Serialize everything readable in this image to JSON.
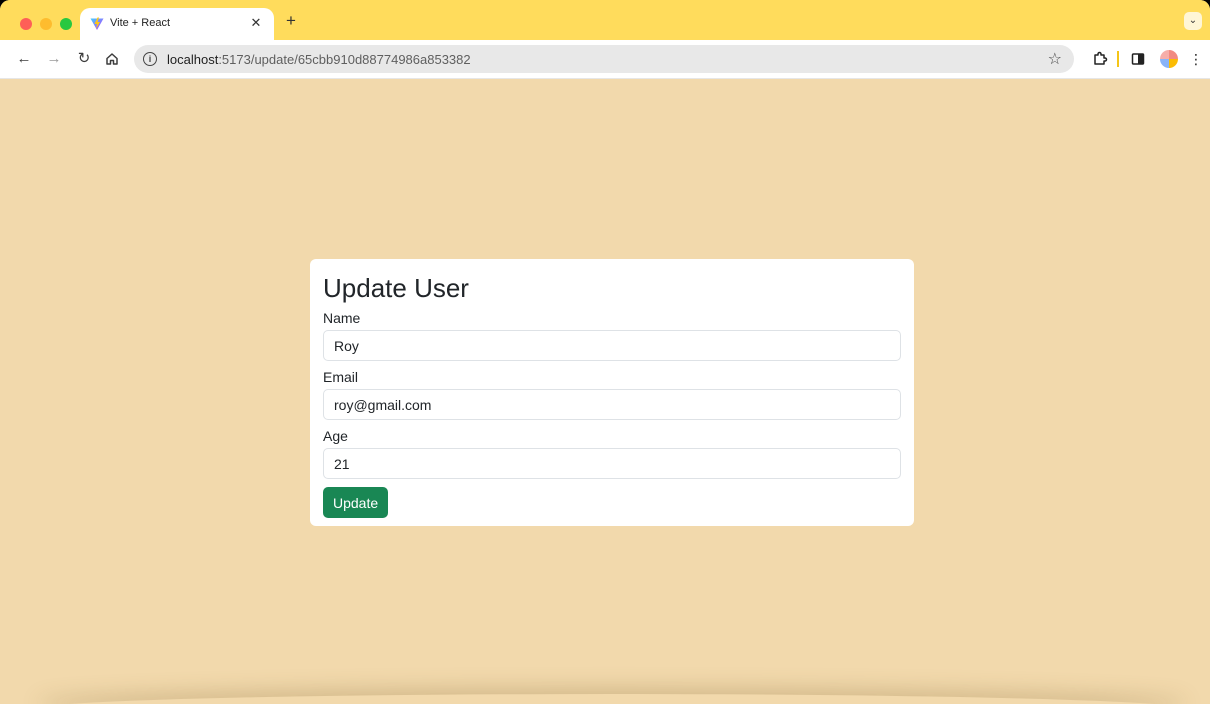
{
  "browser": {
    "tab": {
      "title": "Vite + React",
      "favicon": "vite-logo-icon",
      "close_icon": "close-icon"
    },
    "new_tab_label": "+",
    "address_bar": {
      "host": "localhost",
      "path": ":5173/update/65cbb910d88774986a853382"
    },
    "accent_color": "#ffdc5c"
  },
  "page": {
    "background_color": "#f2d9ac",
    "form": {
      "title": "Update User",
      "fields": [
        {
          "label": "Name",
          "value": "Roy"
        },
        {
          "label": "Email",
          "value": "roy@gmail.com"
        },
        {
          "label": "Age",
          "value": "21"
        }
      ],
      "submit_label": "Update",
      "submit_color": "#198754"
    }
  }
}
